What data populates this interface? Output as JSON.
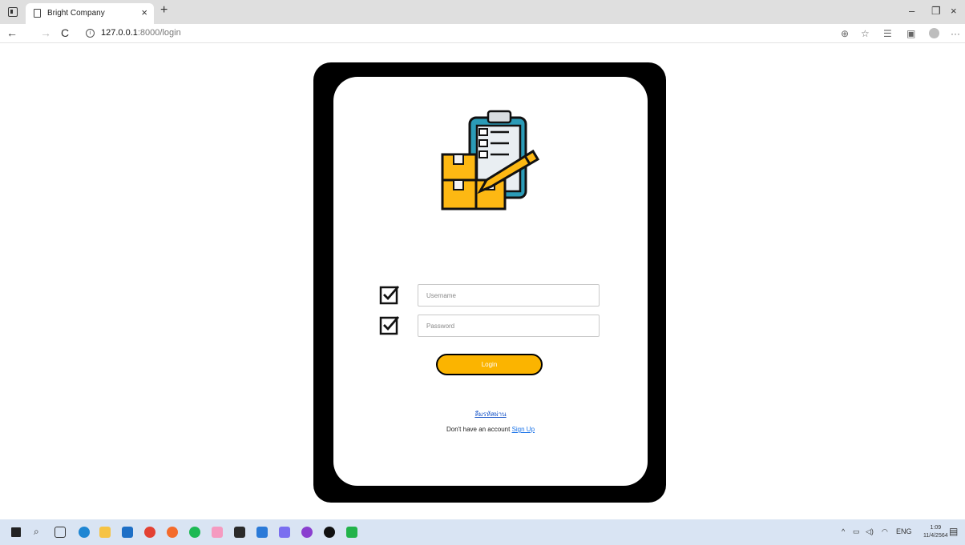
{
  "browser": {
    "tab_title": "Bright Company",
    "tab_close": "×",
    "new_tab": "+",
    "url_host": "127.0.0.1",
    "url_path": ":8000/login",
    "back": "←",
    "forward": "→",
    "refresh": "C",
    "window_controls": {
      "minimize": "–",
      "maximize": "❐",
      "close": "×"
    }
  },
  "login": {
    "username_placeholder": "Username",
    "password_placeholder": "Password",
    "login_label": "Login",
    "forgot_password": "ลืมรหัสผ่าน",
    "no_account_text": "Don't have an account",
    "signup_label": "Sign Up"
  },
  "taskbar": {
    "lang": "ENG",
    "time": "1:09",
    "date": "11/4/2564"
  },
  "colors": {
    "login_button": "#fbb400",
    "frame": "#000000",
    "link": "#1a73e8",
    "taskbar": "#d9e4f3"
  }
}
